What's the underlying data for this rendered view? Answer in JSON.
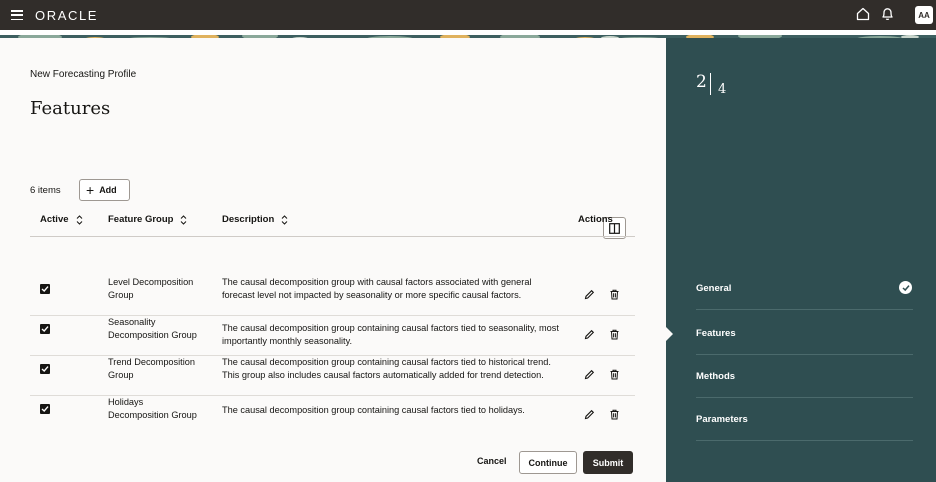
{
  "app": {
    "logo": "ORACLE",
    "avatar_initials": "AA"
  },
  "header": {
    "profile_title": "New Forecasting Profile",
    "page_title": "Features"
  },
  "toolbar": {
    "count_label": "6 items",
    "add_label": "Add"
  },
  "table": {
    "columns": [
      "Active",
      "Feature Group",
      "Description",
      "Actions"
    ],
    "rows": [
      {
        "active": true,
        "group": "Level Decomposition Group",
        "description": "The causal decomposition group with causal factors associated with general forecast level not impacted by seasonality or more specific causal factors."
      },
      {
        "active": true,
        "group": "Seasonality Decomposition Group",
        "description": "The causal decomposition group containing causal factors tied to seasonality, most importantly monthly seasonality."
      },
      {
        "active": true,
        "group": "Trend Decomposition Group",
        "description": "The causal decomposition group containing causal factors tied to historical trend. This group also includes causal factors automatically added for trend detection."
      },
      {
        "active": true,
        "group": "Holidays Decomposition Group",
        "description": "The causal decomposition group containing causal factors tied to holidays."
      }
    ]
  },
  "footer": {
    "cancel_label": "Cancel",
    "continue_label": "Continue",
    "submit_label": "Submit"
  },
  "progress": {
    "current": "2",
    "total": "4"
  },
  "steps": [
    {
      "label": "General",
      "done": true
    },
    {
      "label": "Features",
      "current": true
    },
    {
      "label": "Methods"
    },
    {
      "label": "Parameters"
    }
  ],
  "colors": {
    "topbar": "#312d2a",
    "side_panel": "#2f4e51",
    "accent_dark": "#161513"
  }
}
